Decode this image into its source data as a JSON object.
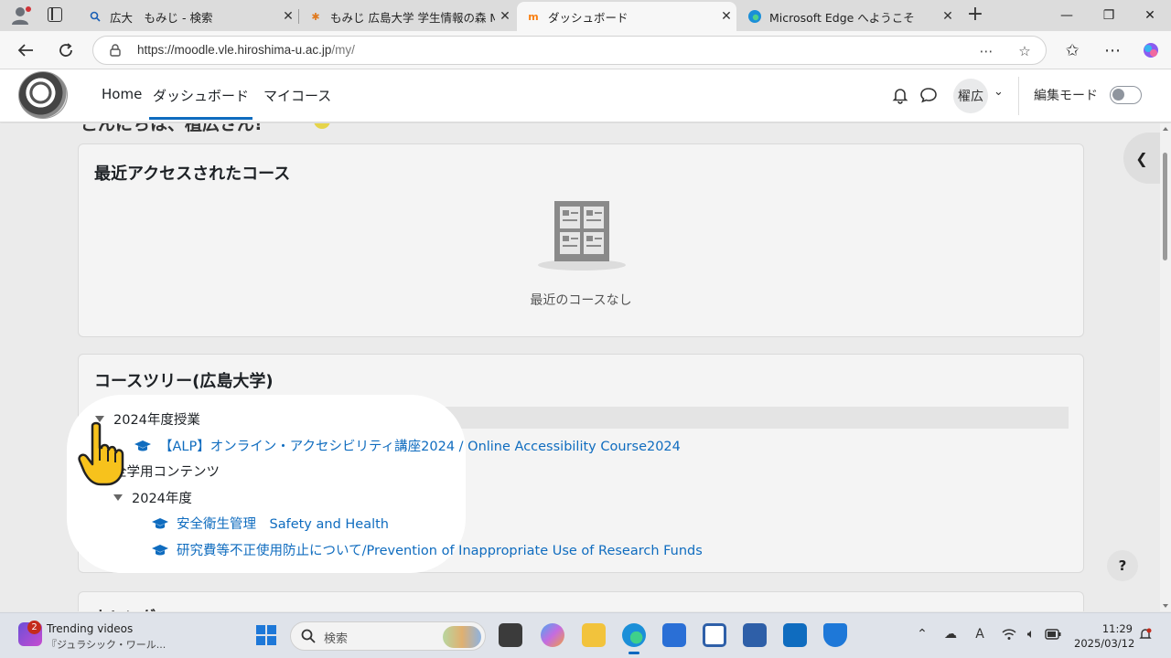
{
  "browser": {
    "tabs": [
      {
        "title": "広大　もみじ - 検索",
        "icon": "search-icon"
      },
      {
        "title": "もみじ 広島大学 学生情報の森 MOM",
        "icon": "maple-leaf-icon"
      },
      {
        "title": "ダッシュボード",
        "icon": "moodle-icon",
        "active": true
      },
      {
        "title": "Microsoft Edge へようこそ",
        "icon": "edge-icon"
      }
    ],
    "url_main": "https://moodle.vle.hiroshima-u.ac.jp",
    "url_path": "/my/"
  },
  "moodle": {
    "nav": {
      "home": "Home",
      "dashboard": "ダッシュボード",
      "my_courses": "マイコース",
      "user_initials": "櫂広",
      "edit_mode": "編集モード"
    },
    "recent": {
      "title": "最近アクセスされたコース",
      "empty": "最近のコースなし"
    },
    "tree": {
      "title": "コースツリー(広島大学)",
      "cat1": "2024年度授業",
      "course1": "【ALP】オンライン・アクセシビリティ講座2024 / Online Accessibility Course2024",
      "cat2": "全学用コンテンツ",
      "cat2_sub": "2024年度",
      "course2": "安全衛生管理　Safety and Health",
      "course3": "研究費等不正使用防止について/Prevention of Inappropriate Use of Research Funds"
    },
    "help": "?"
  },
  "taskbar": {
    "news_badge": "2",
    "news_title": "Trending videos",
    "news_sub": "『ジュラシック・ワール...",
    "search_placeholder": "検索",
    "time": "11:29",
    "date": "2025/03/12",
    "ime": "A"
  },
  "colors": {
    "accent": "#0f6cbf",
    "link": "#0f6cbf"
  }
}
